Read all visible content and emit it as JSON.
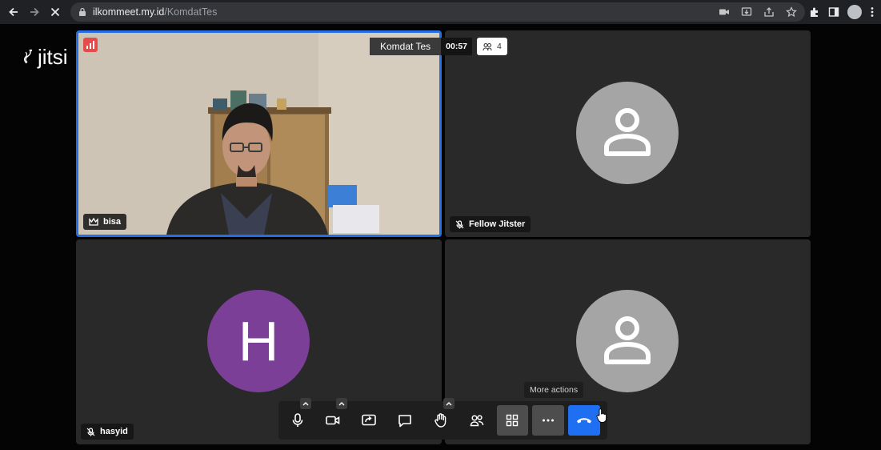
{
  "browser": {
    "url_host": "ilkommeet.my.id",
    "url_path": "/KomdatTes"
  },
  "app": {
    "logo_text": "jitsi"
  },
  "meeting": {
    "subject": "Komdat Tes",
    "timer": "00:57",
    "participant_count": "4"
  },
  "tiles": [
    {
      "name": "bisa",
      "role": "moderator",
      "video": true
    },
    {
      "name": "Fellow Jitster",
      "muted": true
    },
    {
      "name": "hasyid",
      "initial": "H",
      "muted": true,
      "avatar_color": "#7b3f98"
    },
    {
      "name": "",
      "muted": false
    }
  ],
  "toolbar": {
    "tooltip": "More actions",
    "accent_color": "#1f6ff2",
    "buttons": [
      "microphone-icon",
      "camera-icon",
      "share-screen-icon",
      "chat-icon",
      "raise-hand-icon",
      "participants-icon",
      "tile-view-icon",
      "more-actions-icon",
      "hangup-icon"
    ]
  }
}
